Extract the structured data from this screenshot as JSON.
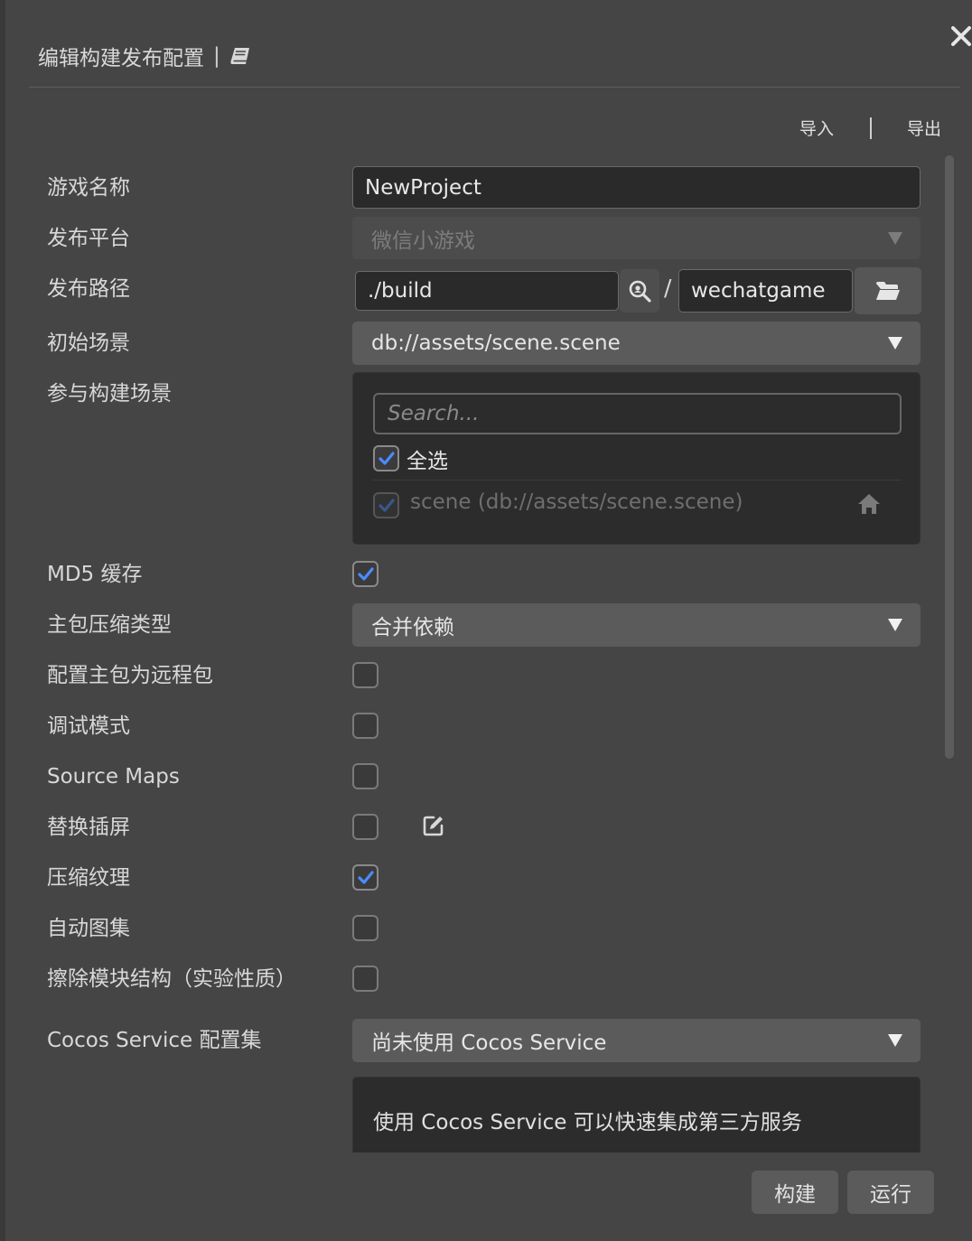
{
  "header": {
    "title": "编辑构建发布配置",
    "separator": "|"
  },
  "io": {
    "import_label": "导入",
    "export_label": "导出"
  },
  "fields": {
    "game_name": {
      "label": "游戏名称",
      "value": "NewProject"
    },
    "platform": {
      "label": "发布平台",
      "value": "微信小游戏"
    },
    "build_path": {
      "label": "发布路径",
      "path": "./build",
      "slash": "/",
      "folder": "wechatgame"
    },
    "start_scene": {
      "label": "初始场景",
      "value": "db://assets/scene.scene"
    },
    "scenes": {
      "label": "参与构建场景",
      "search_placeholder": "Search...",
      "select_all_label": "全选",
      "items": [
        {
          "label": "scene (db://assets/scene.scene)",
          "checked": true
        }
      ]
    },
    "md5": {
      "label": "MD5 缓存",
      "checked": true
    },
    "compression": {
      "label": "主包压缩类型",
      "value": "合并依赖"
    },
    "remote_main": {
      "label": "配置主包为远程包",
      "checked": false
    },
    "debug": {
      "label": "调试模式",
      "checked": false
    },
    "source_maps": {
      "label": "Source Maps",
      "checked": false
    },
    "splash": {
      "label": "替换插屏",
      "checked": false
    },
    "texture": {
      "label": "压缩纹理",
      "checked": true
    },
    "auto_atlas": {
      "label": "自动图集",
      "checked": false
    },
    "erase_module": {
      "label": "擦除模块结构（实验性质）",
      "checked": false
    },
    "cocos_service": {
      "label": "Cocos Service 配置集",
      "value": "尚未使用 Cocos Service",
      "info": "使用 Cocos Service 可以快速集成第三方服务"
    }
  },
  "actions": {
    "build_label": "构建",
    "run_label": "运行"
  },
  "colors": {
    "background": "#454545",
    "input_bg": "#2a2a2a",
    "select_bg": "#5b5b5b",
    "check_accent": "#4a8cff"
  }
}
